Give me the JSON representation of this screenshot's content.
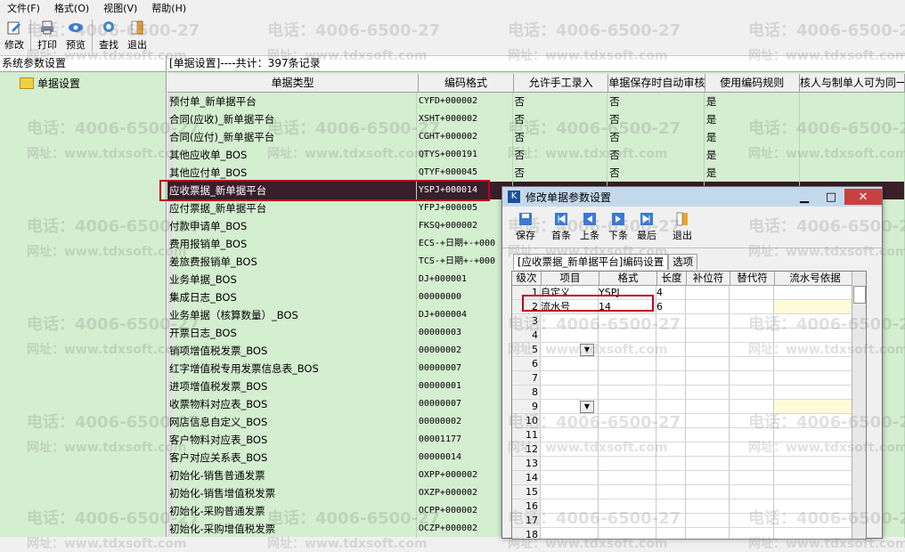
{
  "menu": [
    "文件(F)",
    "格式(O)",
    "视图(V)",
    "帮助(H)"
  ],
  "toolbar": [
    "修改",
    "打印",
    "预览",
    "查找",
    "退出"
  ],
  "left": {
    "title": "系统参数设置",
    "tree_item": "单据设置"
  },
  "right": {
    "header": "[单据设置]----共计：397条记录"
  },
  "grid": {
    "columns": [
      "单据类型",
      "编码格式",
      "允许手工录入",
      "单据保存时自动审核",
      "使用编码规则",
      "核人与制单人可为同一职"
    ],
    "rows": [
      [
        "预付单_新单据平台",
        "CYFD+000002",
        "否",
        "否",
        "是",
        ""
      ],
      [
        "合同(应收)_新单据平台",
        "XSHT+000002",
        "否",
        "否",
        "是",
        ""
      ],
      [
        "合同(应付)_新单据平台",
        "CGHT+000002",
        "否",
        "否",
        "是",
        ""
      ],
      [
        "其他应收单_BOS",
        "QTYS+000191",
        "否",
        "否",
        "是",
        ""
      ],
      [
        "其他应付单_BOS",
        "QTYF+000045",
        "否",
        "否",
        "是",
        ""
      ],
      [
        "应收票据_新单据平台",
        "YSPJ+000014",
        "",
        "",
        "",
        ""
      ],
      [
        "应付票据_新单据平台",
        "YFPJ+000005",
        "",
        "",
        "",
        ""
      ],
      [
        "付款申请单_BOS",
        "FKSQ+000002",
        "",
        "",
        "",
        ""
      ],
      [
        "费用报销单_BOS",
        "ECS-+日期+-+000",
        "",
        "",
        "",
        ""
      ],
      [
        "差旅费报销单_BOS",
        "TCS-+日期+-+000",
        "",
        "",
        "",
        ""
      ],
      [
        "业务单据_BOS",
        "DJ+000001",
        "",
        "",
        "",
        ""
      ],
      [
        "集成日志_BOS",
        "00000000",
        "",
        "",
        "",
        ""
      ],
      [
        "业务单据（核算数量）_BOS",
        "DJ+000004",
        "",
        "",
        "",
        ""
      ],
      [
        "开票日志_BOS",
        "00000003",
        "",
        "",
        "",
        ""
      ],
      [
        "销项增值税发票_BOS",
        "00000002",
        "",
        "",
        "",
        ""
      ],
      [
        "红字增值税专用发票信息表_BOS",
        "00000007",
        "",
        "",
        "",
        ""
      ],
      [
        "进项增值税发票_BOS",
        "00000001",
        "",
        "",
        "",
        ""
      ],
      [
        "收票物料对应表_BOS",
        "00000007",
        "",
        "",
        "",
        ""
      ],
      [
        "网店信息自定义_BOS",
        "00000002",
        "",
        "",
        "",
        ""
      ],
      [
        "客户物料对应表_BOS",
        "00001177",
        "",
        "",
        "",
        ""
      ],
      [
        "客户对应关系表_BOS",
        "00000014",
        "",
        "",
        "",
        ""
      ],
      [
        "初始化-销售普通发票",
        "OXPP+000002",
        "",
        "",
        "",
        ""
      ],
      [
        "初始化-销售增值税发票",
        "OXZP+000002",
        "",
        "",
        "",
        ""
      ],
      [
        "初始化-采购普通发票",
        "OCPP+000002",
        "",
        "",
        "",
        ""
      ],
      [
        "初始化-采购增值税发票",
        "OCZP+000002",
        "",
        "",
        "",
        ""
      ]
    ]
  },
  "dialog": {
    "title": "修改单据参数设置",
    "toolbar": [
      "保存",
      "首条",
      "上条",
      "下条",
      "最后",
      "退出"
    ],
    "tabs": [
      "[应收票据_新单据平台]编码设置",
      "选项"
    ],
    "columns": [
      "级次",
      "项目",
      "格式",
      "长度",
      "补位符",
      "替代符",
      "流水号依据"
    ],
    "rows": [
      [
        "1",
        "自定义",
        "YSPJ",
        "4",
        "",
        "",
        ""
      ],
      [
        "2",
        "流水号",
        "14",
        "6",
        "",
        "",
        ""
      ],
      [
        "3",
        "",
        "",
        "",
        "",
        "",
        ""
      ],
      [
        "4",
        "",
        "",
        "",
        "",
        "",
        ""
      ],
      [
        "5",
        "",
        "",
        "",
        "",
        "",
        ""
      ],
      [
        "6",
        "",
        "",
        "",
        "",
        "",
        ""
      ],
      [
        "7",
        "",
        "",
        "",
        "",
        "",
        ""
      ],
      [
        "8",
        "",
        "",
        "",
        "",
        "",
        ""
      ],
      [
        "9",
        "",
        "",
        "",
        "",
        "",
        ""
      ],
      [
        "10",
        "",
        "",
        "",
        "",
        "",
        ""
      ],
      [
        "11",
        "",
        "",
        "",
        "",
        "",
        ""
      ],
      [
        "12",
        "",
        "",
        "",
        "",
        "",
        ""
      ],
      [
        "13",
        "",
        "",
        "",
        "",
        "",
        ""
      ],
      [
        "14",
        "",
        "",
        "",
        "",
        "",
        ""
      ],
      [
        "15",
        "",
        "",
        "",
        "",
        "",
        ""
      ],
      [
        "16",
        "",
        "",
        "",
        "",
        "",
        ""
      ],
      [
        "17",
        "",
        "",
        "",
        "",
        "",
        ""
      ],
      [
        "18",
        "",
        "",
        "",
        "",
        "",
        ""
      ]
    ]
  },
  "watermark": {
    "phone": "电话：4006-6500-27",
    "site": "网址：www.tdxsoft.com"
  }
}
